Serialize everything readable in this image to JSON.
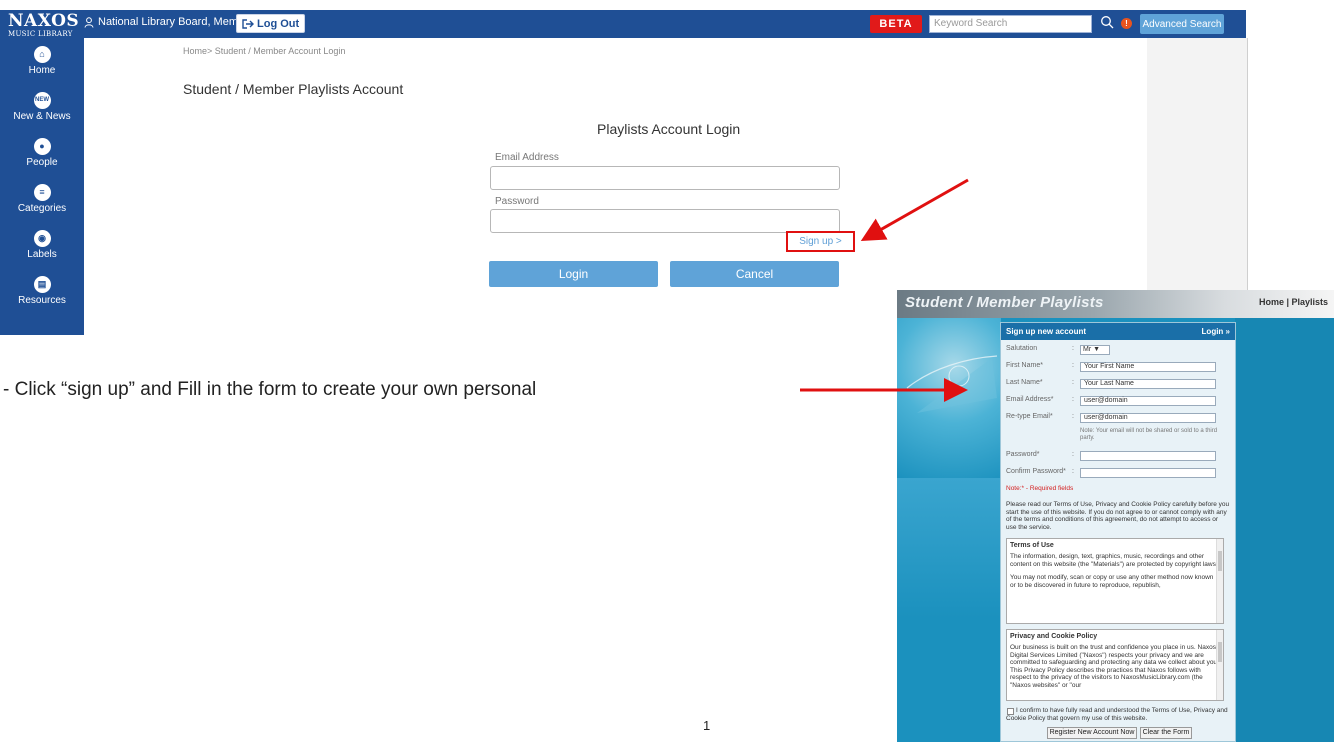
{
  "header": {
    "logo_line1": "NAXOS",
    "logo_line2": "MUSIC LIBRARY",
    "user": "National Library Board, Member",
    "logout": "Log Out",
    "beta": "BETA",
    "search_placeholder": "Keyword Search",
    "info": "!",
    "advanced_search": "Advanced Search"
  },
  "nav": [
    {
      "label": "Home",
      "icon": "home-icon"
    },
    {
      "label": "New & News",
      "icon": "new-icon"
    },
    {
      "label": "People",
      "icon": "person-icon"
    },
    {
      "label": "Categories",
      "icon": "categories-icon"
    },
    {
      "label": "Labels",
      "icon": "labels-icon"
    },
    {
      "label": "Resources",
      "icon": "resources-icon"
    }
  ],
  "login_page": {
    "breadcrumb": "Home> Student / Member Account Login",
    "title": "Student / Member Playlists Account",
    "form_title": "Playlists Account Login",
    "email_label": "Email Address",
    "password_label": "Password",
    "signup": "Sign up >",
    "login": "Login",
    "cancel": "Cancel"
  },
  "instruction": "- Click “sign up” and Fill in the form to create your own personal",
  "page_number": "1",
  "signup_page": {
    "title": "Student / Member Playlists",
    "top_links": "Home | Playlists",
    "form_header": "Sign up new account",
    "login_link": "Login »",
    "fields": {
      "salutation_label": "Salutation",
      "salutation_value": "Mr ▼",
      "first_label": "First Name*",
      "first_value": "Your First Name",
      "last_label": "Last Name*",
      "last_value": "Your Last Name",
      "email_label": "Email Address*",
      "email_value": "user@domain",
      "retype_label": "Re-type Email*",
      "retype_value": "user@domain",
      "email_note": "Note: Your email will not be shared or sold to a third party.",
      "password_label": "Password*",
      "confirm_label": "Confirm Password*",
      "colon": ":"
    },
    "required_note": "Note:* - Required fields",
    "read_terms": "Please read our Terms of Use, Privacy and Cookie Policy carefully before you start the use of this website. If you do not agree to or cannot comply with any of the terms and conditions of this agreement, do not attempt to access or use the service.",
    "terms_title": "Terms of Use",
    "terms_p1": "The information, design, text, graphics, music, recordings and other content on this website (the \"Materials\") are protected by copyright laws.",
    "terms_p2": "You may not modify, scan or copy or use any other method now known or to be discovered in future to reproduce, republish,",
    "privacy_title": "Privacy and Cookie Policy",
    "privacy_p1": "Our business is built on the trust and confidence you place in us. Naxos Digital Services Limited (\"Naxos\") respects your privacy and we are committed to safeguarding and protecting any data we collect about you. This Privacy Policy describes the practices that Naxos follows with respect to the privacy of the visitors to NaxosMusicLibrary.com (the \"Naxos websites\" or \"our",
    "confirm_text": "I confirm to have fully read and understood the Terms of Use, Privacy and Cookie Policy that govern my use of this website.",
    "register_button": "Register New Account Now",
    "clear_button": "Clear the Form"
  },
  "colors": {
    "brand_blue": "#1f4f95",
    "button_blue": "#5fa3d8",
    "beta_red": "#e11a1a",
    "highlight_red": "#e01010",
    "signup_bg": "#1b91be"
  }
}
